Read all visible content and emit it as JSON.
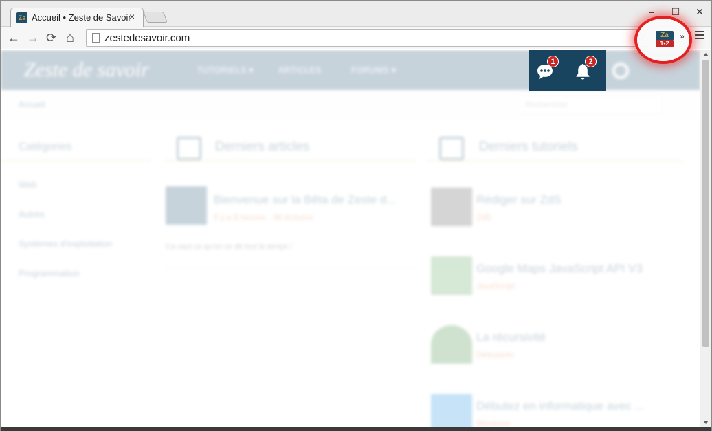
{
  "browser": {
    "tab_title": "Accueil • Zeste de Savoir",
    "tab_close": "×",
    "window_controls": {
      "minimize": "–",
      "maximize": "☐",
      "close": "✕"
    },
    "url": "zestedesavoir.com",
    "nav": {
      "back": "←",
      "forward": "→",
      "reload": "⟳",
      "home": "⌂",
      "star": "☆",
      "overflow": "»"
    }
  },
  "extension": {
    "logo_text": "Za",
    "count_label": "1•2"
  },
  "site": {
    "logo": "Zeste de savoir",
    "nav_items": [
      "TUTORIELS ▾",
      "ARTICLES",
      "FORUMS ▾"
    ],
    "messages_badge": "1",
    "notifications_badge": "2",
    "breadcrumb": "Accueil",
    "search_placeholder": "Rechercher",
    "sidebar_title": "Catégories",
    "sidebar_items": [
      "Web",
      "Autres",
      "Systèmes d'exploitation",
      "Programmation"
    ],
    "articles": {
      "heading": "Derniers articles",
      "items": [
        {
          "title": "Bienvenue sur la Bêta de Zeste d...",
          "sub": "Il y a 8 heures · 46 lectures",
          "desc": "Ca vaut ce qu'on ce dit tout le temps !"
        }
      ]
    },
    "tutorials": {
      "heading": "Derniers tutoriels",
      "items": [
        {
          "title": "Rédiger sur ZdS",
          "sub": "ZdS"
        },
        {
          "title": "Google Maps JavaScript API V3",
          "sub": "JavaScript"
        },
        {
          "title": "La récursivité",
          "sub": "Débutants"
        },
        {
          "title": "Débutez en informatique avec ...",
          "sub": "Windows"
        }
      ]
    }
  },
  "colors": {
    "site_header": "#1d4e6d",
    "badge": "#c52827",
    "accent_orange": "#e0702e",
    "highlight_ring": "#e51a1a"
  }
}
